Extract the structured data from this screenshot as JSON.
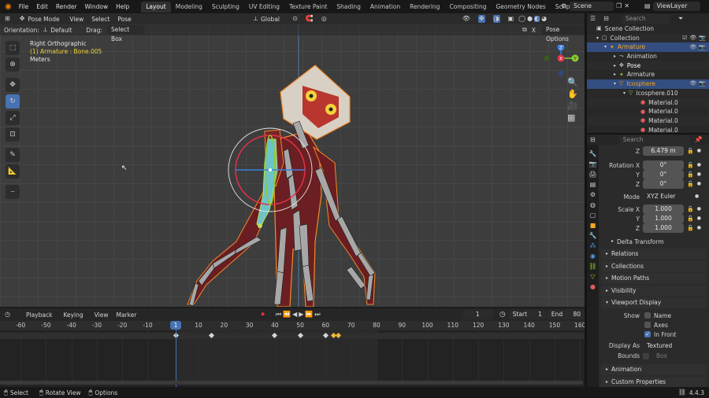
{
  "topbar": {
    "menus": [
      "File",
      "Edit",
      "Render",
      "Window",
      "Help"
    ],
    "workspaces": [
      "Layout",
      "Modeling",
      "Sculpting",
      "UV Editing",
      "Texture Paint",
      "Shading",
      "Animation",
      "Rendering",
      "Compositing",
      "Geometry Nodes",
      "Scripting"
    ],
    "active_workspace": "Layout",
    "add_tab": "+",
    "scene": "Scene",
    "view_layer": "ViewLayer"
  },
  "viewport_header": {
    "mode": "Pose Mode",
    "menus": [
      "View",
      "Select",
      "Pose"
    ],
    "transform_orientation": "Global"
  },
  "viewport_header2": {
    "orientation_label": "Orientation:",
    "orientation_value": "Default",
    "drag_label": "Drag:",
    "drag_value": "Select Box",
    "x_label": "X",
    "pose_options": "Pose Options"
  },
  "viewport_overlay": {
    "view_name": "Right Orthographic",
    "active": "(1) Armature : Bone.005",
    "units": "Meters"
  },
  "navigation_gizmo": {
    "x": "X",
    "y": "Y",
    "z": "Z"
  },
  "timeline": {
    "menus": [
      "Playback",
      "Keying",
      "View",
      "Marker"
    ],
    "current_frame": "1",
    "start_label": "Start",
    "start_value": "1",
    "end_label": "End",
    "end_value": "80",
    "ruler_ticks": [
      "-60",
      "-50",
      "-40",
      "-30",
      "-20",
      "-10",
      "1",
      "10",
      "20",
      "30",
      "40",
      "50",
      "60",
      "70",
      "80",
      "90",
      "100",
      "110",
      "120",
      "130",
      "140",
      "150",
      "160"
    ],
    "keyframes": [
      "1",
      "15",
      "40",
      "50",
      "60",
      "63",
      "65"
    ]
  },
  "status_bar": {
    "select": "Select",
    "rotate": "Rotate View",
    "options": "Options",
    "version": "4.4.3"
  },
  "outliner": {
    "search_placeholder": "Search",
    "rows": [
      {
        "label": "Scene Collection"
      },
      {
        "label": "Collection"
      },
      {
        "label": "Armature"
      },
      {
        "label": "Animation"
      },
      {
        "label": "Pose"
      },
      {
        "label": "Armature"
      },
      {
        "label": "Icosphere"
      },
      {
        "label": "Icosphere.010"
      },
      {
        "label": "Material.0"
      },
      {
        "label": "Material.0"
      },
      {
        "label": "Material.0"
      },
      {
        "label": "Material.0"
      }
    ]
  },
  "properties": {
    "search_placeholder": "Search",
    "location_z": {
      "label": "Z",
      "value": "6.479 m"
    },
    "rotation": [
      {
        "label": "Rotation X",
        "value": "0°"
      },
      {
        "label": "Y",
        "value": "0°"
      },
      {
        "label": "Z",
        "value": "0°"
      }
    ],
    "mode": {
      "label": "Mode",
      "value": "XYZ Euler"
    },
    "scale": [
      {
        "label": "Scale X",
        "value": "1.000"
      },
      {
        "label": "Y",
        "value": "1.000"
      },
      {
        "label": "Z",
        "value": "1.000"
      }
    ],
    "delta_transform": "Delta Transform",
    "panels_top": [
      "Relations",
      "Collections",
      "Motion Paths",
      "Visibility"
    ],
    "viewport_display": {
      "title": "Viewport Display",
      "show_label": "Show",
      "options": [
        {
          "label": "Name",
          "checked": false
        },
        {
          "label": "Axes",
          "checked": false
        },
        {
          "label": "In Front",
          "checked": true
        }
      ],
      "display_as_label": "Display As",
      "display_as_value": "Textured",
      "bounds_label": "Bounds",
      "bounds_value": "Box"
    },
    "panels_bottom": [
      "Animation",
      "Custom Properties"
    ]
  },
  "colors": {
    "accent": "#4772b3",
    "selected_orange": "#f5a623",
    "viewport_bg": "#3d3d3d",
    "x_axis": "#e3304a",
    "y_axis": "#8ccd2e",
    "z_axis": "#3a7fe0"
  }
}
